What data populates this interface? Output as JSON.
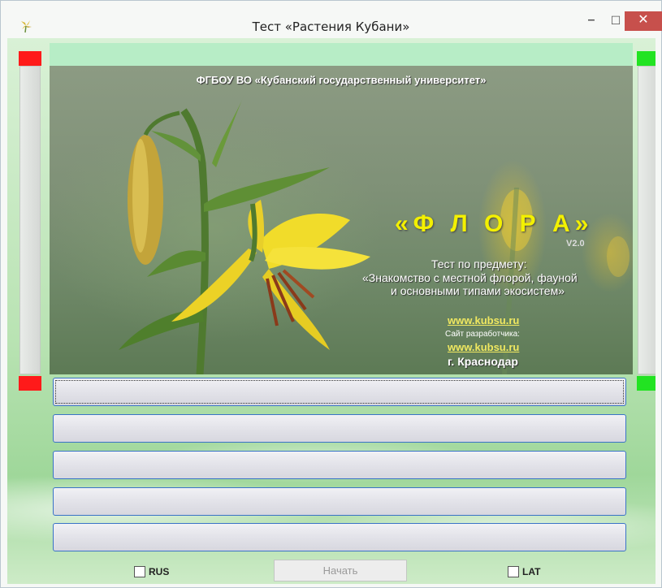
{
  "window": {
    "title": "Тест «Растения Кубани»",
    "icons": {
      "app": "flower-icon",
      "minimize": "minimize-icon",
      "maximize": "maximize-icon",
      "close": "close-icon"
    },
    "minimize_glyph": "–",
    "maximize_glyph": "☐",
    "close_glyph": "✕"
  },
  "colors": {
    "red_indicator": "#ff1a1a",
    "green_indicator": "#22e322",
    "top_strip": "#b7edc6",
    "answer_border": "#3a73c7",
    "flora_title": "#f3f000"
  },
  "banner": {
    "organization": "ФГБОУ ВО «Кубанский государственный университет»",
    "product_title": "«Ф Л О Р А»",
    "version": "V2.0",
    "subject_line1": "Тест по предмету:",
    "subject_line2": "«Знакомство с местной флорой, фауной",
    "subject_line3": "и основными типами экосистем»",
    "site_link": "www.kubsu.ru",
    "developer_label": "Сайт разработчика:",
    "developer_link": "www.kubsu.ru",
    "city": "г. Краснодар"
  },
  "answers": [
    "",
    "",
    "",
    "",
    ""
  ],
  "bottom": {
    "rus_label": "RUS",
    "rus_checked": false,
    "start_label": "Начать",
    "start_enabled": false,
    "lat_label": "LAT",
    "lat_checked": false
  }
}
